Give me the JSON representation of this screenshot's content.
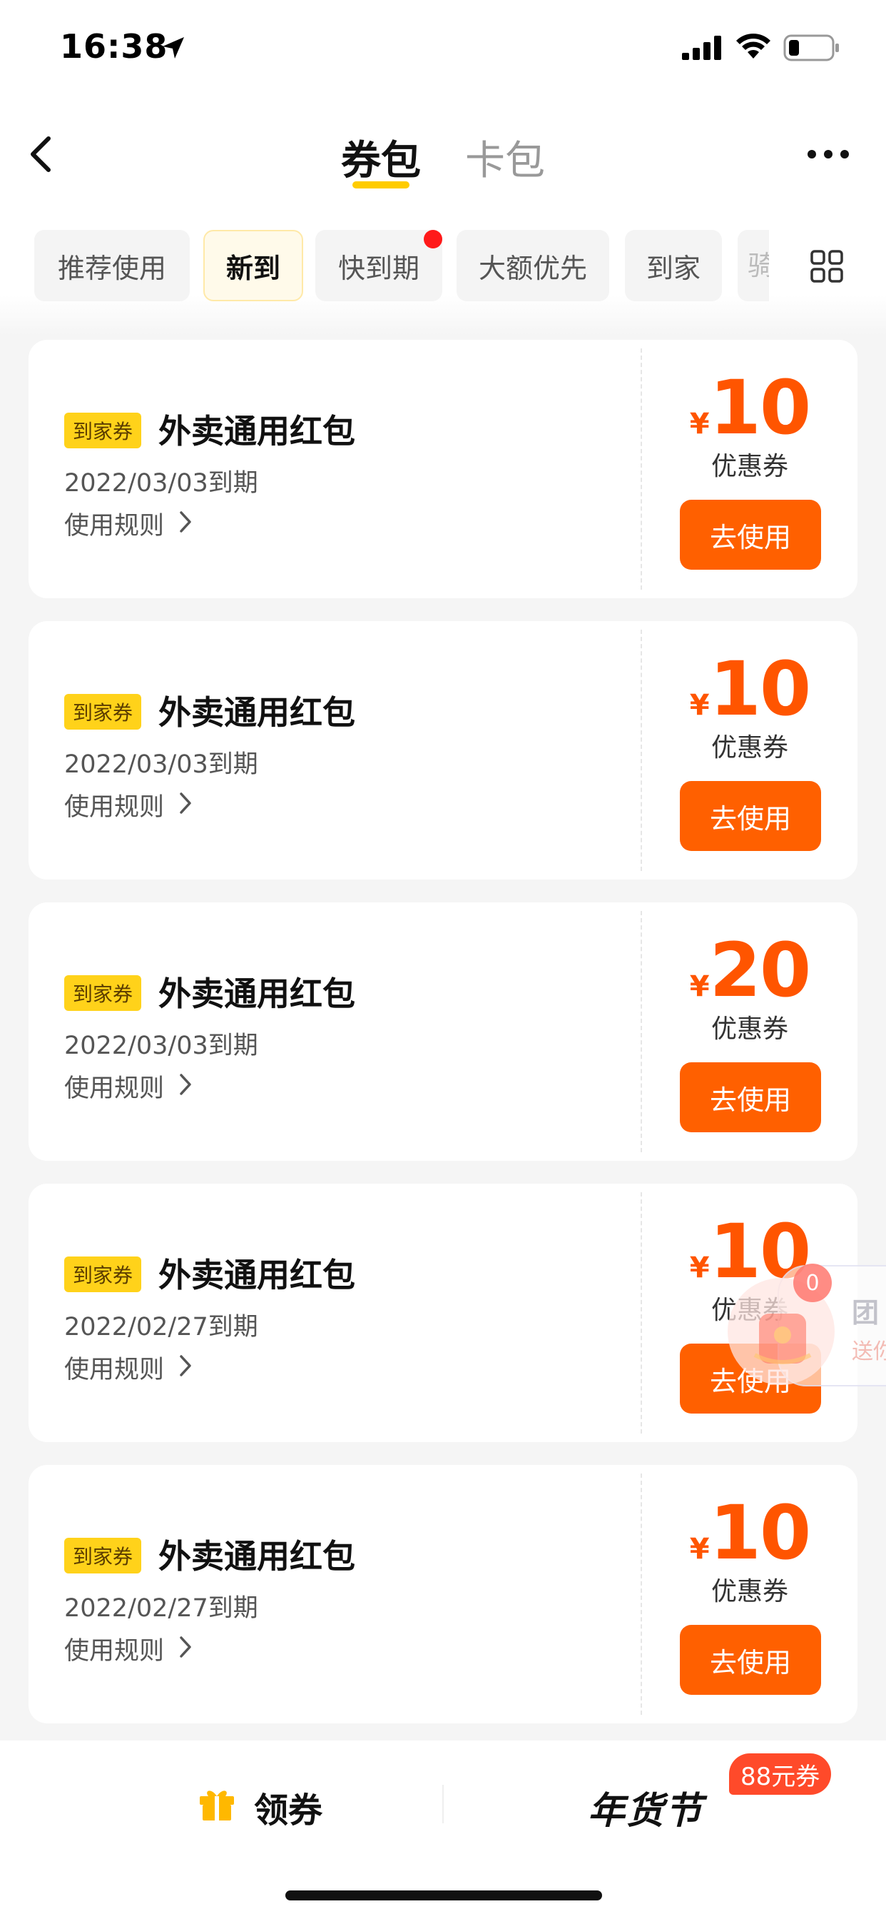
{
  "status_bar": {
    "time": "16:38",
    "icons": [
      "location-arrow-icon",
      "signal-icon",
      "wifi-icon",
      "battery-icon"
    ]
  },
  "nav": {
    "back_icon": "back-arrow-icon",
    "tabs": [
      {
        "label": "券包",
        "active": true
      },
      {
        "label": "卡包",
        "active": false
      }
    ],
    "more_icon": "more-dots-icon"
  },
  "filters": {
    "chips": [
      {
        "label": "推荐使用",
        "active": false
      },
      {
        "label": "新到",
        "active": true
      },
      {
        "label": "快到期",
        "active": false,
        "red_dot": true
      },
      {
        "label": "大额优先",
        "active": false
      },
      {
        "label": "到家",
        "active": false
      }
    ],
    "partial_chip": "骑",
    "grid_icon": "grid-icon"
  },
  "coupons": [
    {
      "tag": "到家券",
      "title": "外卖通用红包",
      "expiry": "2022/03/03到期",
      "rules": "使用规则",
      "currency": "¥",
      "amount": "10",
      "type": "优惠券",
      "button": "去使用"
    },
    {
      "tag": "到家券",
      "title": "外卖通用红包",
      "expiry": "2022/03/03到期",
      "rules": "使用规则",
      "currency": "¥",
      "amount": "10",
      "type": "优惠券",
      "button": "去使用"
    },
    {
      "tag": "到家券",
      "title": "外卖通用红包",
      "expiry": "2022/03/03到期",
      "rules": "使用规则",
      "currency": "¥",
      "amount": "20",
      "type": "优惠券",
      "button": "去使用"
    },
    {
      "tag": "到家券",
      "title": "外卖通用红包",
      "expiry": "2022/02/27到期",
      "rules": "使用规则",
      "currency": "¥",
      "amount": "10",
      "type": "优惠券",
      "button": "去使用"
    },
    {
      "tag": "到家券",
      "title": "外卖通用红包",
      "expiry": "2022/02/27到期",
      "rules": "使用规则",
      "currency": "¥",
      "amount": "10",
      "type": "优惠券",
      "button": "去使用"
    }
  ],
  "float_widget": {
    "badge": "0",
    "title": "团",
    "subtitle": "送你"
  },
  "bottom_bar": {
    "left_label": "领券",
    "left_icon": "gift-icon",
    "right_label": "年货节",
    "right_badge": "88元券"
  },
  "colors": {
    "accent_orange": "#ff6000",
    "amount_orange": "#ff5500",
    "tag_yellow": "#ffd21a",
    "underline_yellow": "#ffcc00",
    "dot_red": "#ff1a1a"
  }
}
